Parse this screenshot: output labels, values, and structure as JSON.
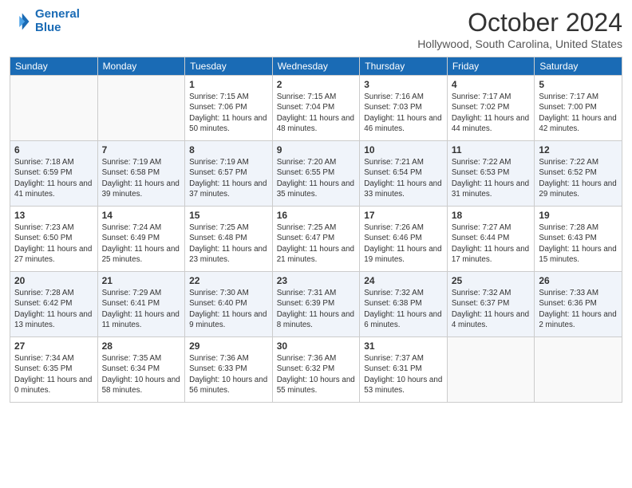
{
  "logo": {
    "line1": "General",
    "line2": "Blue"
  },
  "title": "October 2024",
  "location": "Hollywood, South Carolina, United States",
  "weekdays": [
    "Sunday",
    "Monday",
    "Tuesday",
    "Wednesday",
    "Thursday",
    "Friday",
    "Saturday"
  ],
  "weeks": [
    [
      {
        "day": "",
        "info": ""
      },
      {
        "day": "",
        "info": ""
      },
      {
        "day": "1",
        "info": "Sunrise: 7:15 AM\nSunset: 7:06 PM\nDaylight: 11 hours and 50 minutes."
      },
      {
        "day": "2",
        "info": "Sunrise: 7:15 AM\nSunset: 7:04 PM\nDaylight: 11 hours and 48 minutes."
      },
      {
        "day": "3",
        "info": "Sunrise: 7:16 AM\nSunset: 7:03 PM\nDaylight: 11 hours and 46 minutes."
      },
      {
        "day": "4",
        "info": "Sunrise: 7:17 AM\nSunset: 7:02 PM\nDaylight: 11 hours and 44 minutes."
      },
      {
        "day": "5",
        "info": "Sunrise: 7:17 AM\nSunset: 7:00 PM\nDaylight: 11 hours and 42 minutes."
      }
    ],
    [
      {
        "day": "6",
        "info": "Sunrise: 7:18 AM\nSunset: 6:59 PM\nDaylight: 11 hours and 41 minutes."
      },
      {
        "day": "7",
        "info": "Sunrise: 7:19 AM\nSunset: 6:58 PM\nDaylight: 11 hours and 39 minutes."
      },
      {
        "day": "8",
        "info": "Sunrise: 7:19 AM\nSunset: 6:57 PM\nDaylight: 11 hours and 37 minutes."
      },
      {
        "day": "9",
        "info": "Sunrise: 7:20 AM\nSunset: 6:55 PM\nDaylight: 11 hours and 35 minutes."
      },
      {
        "day": "10",
        "info": "Sunrise: 7:21 AM\nSunset: 6:54 PM\nDaylight: 11 hours and 33 minutes."
      },
      {
        "day": "11",
        "info": "Sunrise: 7:22 AM\nSunset: 6:53 PM\nDaylight: 11 hours and 31 minutes."
      },
      {
        "day": "12",
        "info": "Sunrise: 7:22 AM\nSunset: 6:52 PM\nDaylight: 11 hours and 29 minutes."
      }
    ],
    [
      {
        "day": "13",
        "info": "Sunrise: 7:23 AM\nSunset: 6:50 PM\nDaylight: 11 hours and 27 minutes."
      },
      {
        "day": "14",
        "info": "Sunrise: 7:24 AM\nSunset: 6:49 PM\nDaylight: 11 hours and 25 minutes."
      },
      {
        "day": "15",
        "info": "Sunrise: 7:25 AM\nSunset: 6:48 PM\nDaylight: 11 hours and 23 minutes."
      },
      {
        "day": "16",
        "info": "Sunrise: 7:25 AM\nSunset: 6:47 PM\nDaylight: 11 hours and 21 minutes."
      },
      {
        "day": "17",
        "info": "Sunrise: 7:26 AM\nSunset: 6:46 PM\nDaylight: 11 hours and 19 minutes."
      },
      {
        "day": "18",
        "info": "Sunrise: 7:27 AM\nSunset: 6:44 PM\nDaylight: 11 hours and 17 minutes."
      },
      {
        "day": "19",
        "info": "Sunrise: 7:28 AM\nSunset: 6:43 PM\nDaylight: 11 hours and 15 minutes."
      }
    ],
    [
      {
        "day": "20",
        "info": "Sunrise: 7:28 AM\nSunset: 6:42 PM\nDaylight: 11 hours and 13 minutes."
      },
      {
        "day": "21",
        "info": "Sunrise: 7:29 AM\nSunset: 6:41 PM\nDaylight: 11 hours and 11 minutes."
      },
      {
        "day": "22",
        "info": "Sunrise: 7:30 AM\nSunset: 6:40 PM\nDaylight: 11 hours and 9 minutes."
      },
      {
        "day": "23",
        "info": "Sunrise: 7:31 AM\nSunset: 6:39 PM\nDaylight: 11 hours and 8 minutes."
      },
      {
        "day": "24",
        "info": "Sunrise: 7:32 AM\nSunset: 6:38 PM\nDaylight: 11 hours and 6 minutes."
      },
      {
        "day": "25",
        "info": "Sunrise: 7:32 AM\nSunset: 6:37 PM\nDaylight: 11 hours and 4 minutes."
      },
      {
        "day": "26",
        "info": "Sunrise: 7:33 AM\nSunset: 6:36 PM\nDaylight: 11 hours and 2 minutes."
      }
    ],
    [
      {
        "day": "27",
        "info": "Sunrise: 7:34 AM\nSunset: 6:35 PM\nDaylight: 11 hours and 0 minutes."
      },
      {
        "day": "28",
        "info": "Sunrise: 7:35 AM\nSunset: 6:34 PM\nDaylight: 10 hours and 58 minutes."
      },
      {
        "day": "29",
        "info": "Sunrise: 7:36 AM\nSunset: 6:33 PM\nDaylight: 10 hours and 56 minutes."
      },
      {
        "day": "30",
        "info": "Sunrise: 7:36 AM\nSunset: 6:32 PM\nDaylight: 10 hours and 55 minutes."
      },
      {
        "day": "31",
        "info": "Sunrise: 7:37 AM\nSunset: 6:31 PM\nDaylight: 10 hours and 53 minutes."
      },
      {
        "day": "",
        "info": ""
      },
      {
        "day": "",
        "info": ""
      }
    ]
  ]
}
